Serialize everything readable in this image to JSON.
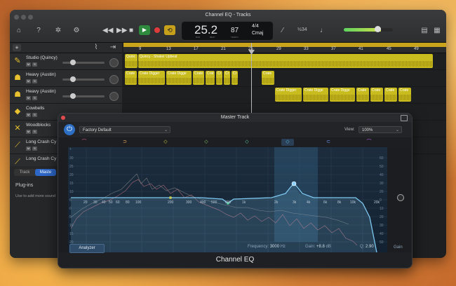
{
  "window": {
    "title": "Channel EQ - Tracks"
  },
  "lcd": {
    "position": "25.2",
    "tempo": "87",
    "time_signature": "4/4",
    "key": "Cmaj",
    "bar_label": "BAR",
    "beat_label": "BEAT",
    "tempo_label": "TEMPO"
  },
  "toolbar": {
    "count_in": "½34",
    "master_volume_fraction": 0.75
  },
  "ruler": {
    "bars": [
      "9",
      "13",
      "17",
      "21",
      "25",
      "29",
      "33",
      "37",
      "41",
      "45",
      "49"
    ]
  },
  "tracks": [
    {
      "name": "Studio (Quincy)",
      "icon": "drums-icon",
      "regions": [
        {
          "label": "Quinc"
        },
        {
          "label": "Quincy - Shaker Upbeat"
        }
      ]
    },
    {
      "name": "Heavy (Austin)",
      "icon": "drums-icon",
      "regions": [
        {
          "label": "Crate"
        },
        {
          "label": "Crate Digger"
        },
        {
          "label": "Crate Digge"
        },
        {
          "label": "Crate"
        },
        {
          "label": "Crat"
        },
        {
          "label": "Cr"
        },
        {
          "label": "Cr"
        },
        {
          "label": "Cr"
        },
        {
          "label": "Crate"
        }
      ]
    },
    {
      "name": "Heavy (Austin)",
      "icon": "drums-icon",
      "regions": [
        {
          "label": "Crate Digger"
        },
        {
          "label": "Crate Digge"
        },
        {
          "label": "Crate Digge"
        },
        {
          "label": "Crate"
        },
        {
          "label": "Crate"
        },
        {
          "label": "Crate"
        },
        {
          "label": "Crate"
        }
      ]
    },
    {
      "name": "Cowbells",
      "icon": "cowbell-icon",
      "regions": []
    },
    {
      "name": "Woodblocks",
      "icon": "woodblock-icon",
      "regions": []
    },
    {
      "name": "Long Crash Cy",
      "icon": "cymbal-icon",
      "regions": []
    },
    {
      "name": "Long Crash Cy",
      "icon": "cymbal-icon",
      "regions": []
    }
  ],
  "inspector": {
    "tab_track": "Track",
    "tab_master": "Maste",
    "plugins_label": "Plug-ins",
    "hint": "Use to add more sound"
  },
  "eq": {
    "window_title": "Master Track",
    "preset": "Factory Default",
    "view_label": "View:",
    "view_value": "100%",
    "db_left": [
      "+",
      "30",
      "25",
      "20",
      "15",
      "10",
      "5",
      "0",
      "5",
      "10",
      "15",
      "20",
      "25",
      "30"
    ],
    "db_right": [
      "60",
      "50",
      "40",
      "30",
      "20",
      "10",
      "0",
      "10",
      "20",
      "30",
      "40",
      "50",
      "60"
    ],
    "freq_labels": [
      "20",
      "30",
      "40",
      "50",
      "60",
      "80",
      "100",
      "200",
      "300",
      "400",
      "500",
      "800",
      "1k",
      "2k",
      "3k",
      "4k",
      "6k",
      "8k",
      "10k",
      "20k"
    ],
    "analyzer_label": "Analyzer",
    "frequency_label": "Frequency:",
    "frequency_value": "3000",
    "frequency_unit": "Hz",
    "gain_label": "Gain:",
    "gain_value": "+8.8",
    "gain_unit": "dB",
    "q_label": "Q:",
    "q_value": "2.90",
    "output_gain_label": "Gain",
    "plugin_name": "Channel EQ",
    "colors": {
      "band1": "#e05d8a",
      "band2": "#e0a45d",
      "band3": "#d6d64a",
      "band4": "#8bd66a",
      "band5": "#5ed6a0",
      "band6": "#58c3e8",
      "band7": "#6a8be0",
      "band8": "#c45de0",
      "curve": "#7ec8f0",
      "selected_band": "#8fd3ff"
    }
  }
}
